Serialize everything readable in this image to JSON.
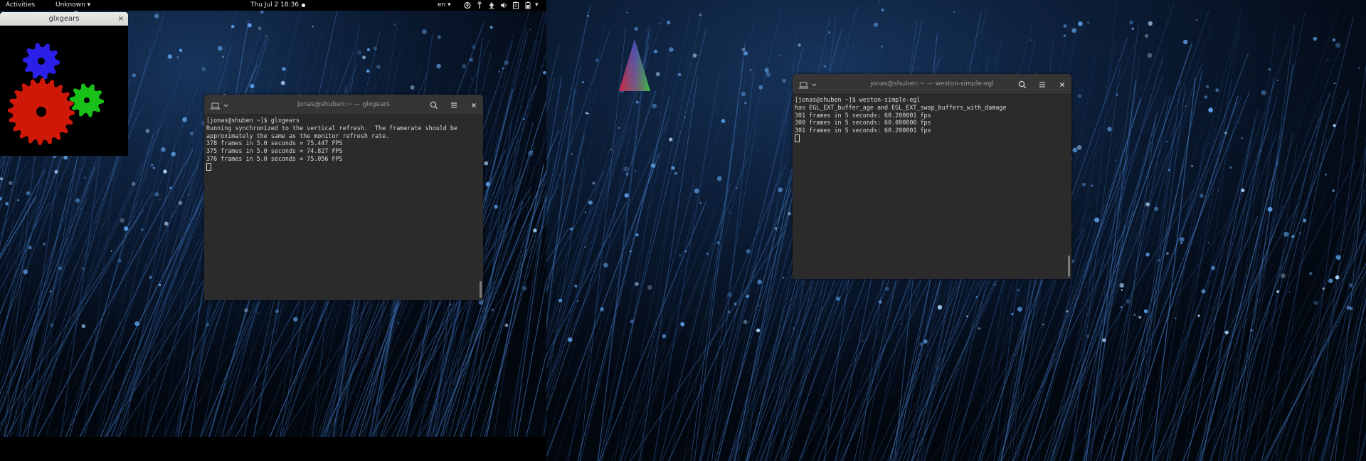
{
  "topbar": {
    "activities": "Activities",
    "app_menu": "Unknown",
    "app_menu_arrow": "▾",
    "clock": "Thu Jul 2  18:36",
    "keyboard_layout": "en",
    "keyboard_arrow": "▾",
    "system_arrow": "▾",
    "tray_icons": [
      "accessibility-icon",
      "network-icon",
      "upload-icon",
      "volume-icon",
      "clipboard-icon",
      "battery-icon"
    ]
  },
  "glxgears_window": {
    "title": "glxgears",
    "close": "×",
    "gear_colors": [
      "#2a20e8",
      "#d01808",
      "#18c018"
    ]
  },
  "terminal_left": {
    "title": "jonas@shuben:~ — glxgears",
    "lines": [
      "[jonas@shuben ~]$ glxgears",
      "Running synchronized to the vertical refresh.  The framerate should be",
      "approximately the same as the monitor refresh rate.",
      "378 frames in 5.0 seconds = 75.447 FPS",
      "375 frames in 5.0 seconds = 74.827 FPS",
      "376 frames in 5.0 seconds = 75.056 FPS"
    ]
  },
  "terminal_right": {
    "title": "jonas@shuben:~ — weston-simple-egl",
    "lines": [
      "[jonas@shuben ~]$ weston-simple-egl",
      "has EGL_EXT_buffer_age and EGL_EXT_swap_buffers_with_damage",
      "301 frames in 5 seconds: 60.200001 fps",
      "300 frames in 5 seconds: 60.000000 fps",
      "301 frames in 5 seconds: 60.200001 fps"
    ]
  },
  "colors": {
    "wallpaper_dark": "#02060d",
    "fiber_blue": "#4a86d0",
    "terminal_bg": "#2b2b2b",
    "terminal_header": "#353535",
    "triangle_top": "#2030ff",
    "triangle_left": "#ff1010",
    "triangle_right": "#10ff10"
  }
}
